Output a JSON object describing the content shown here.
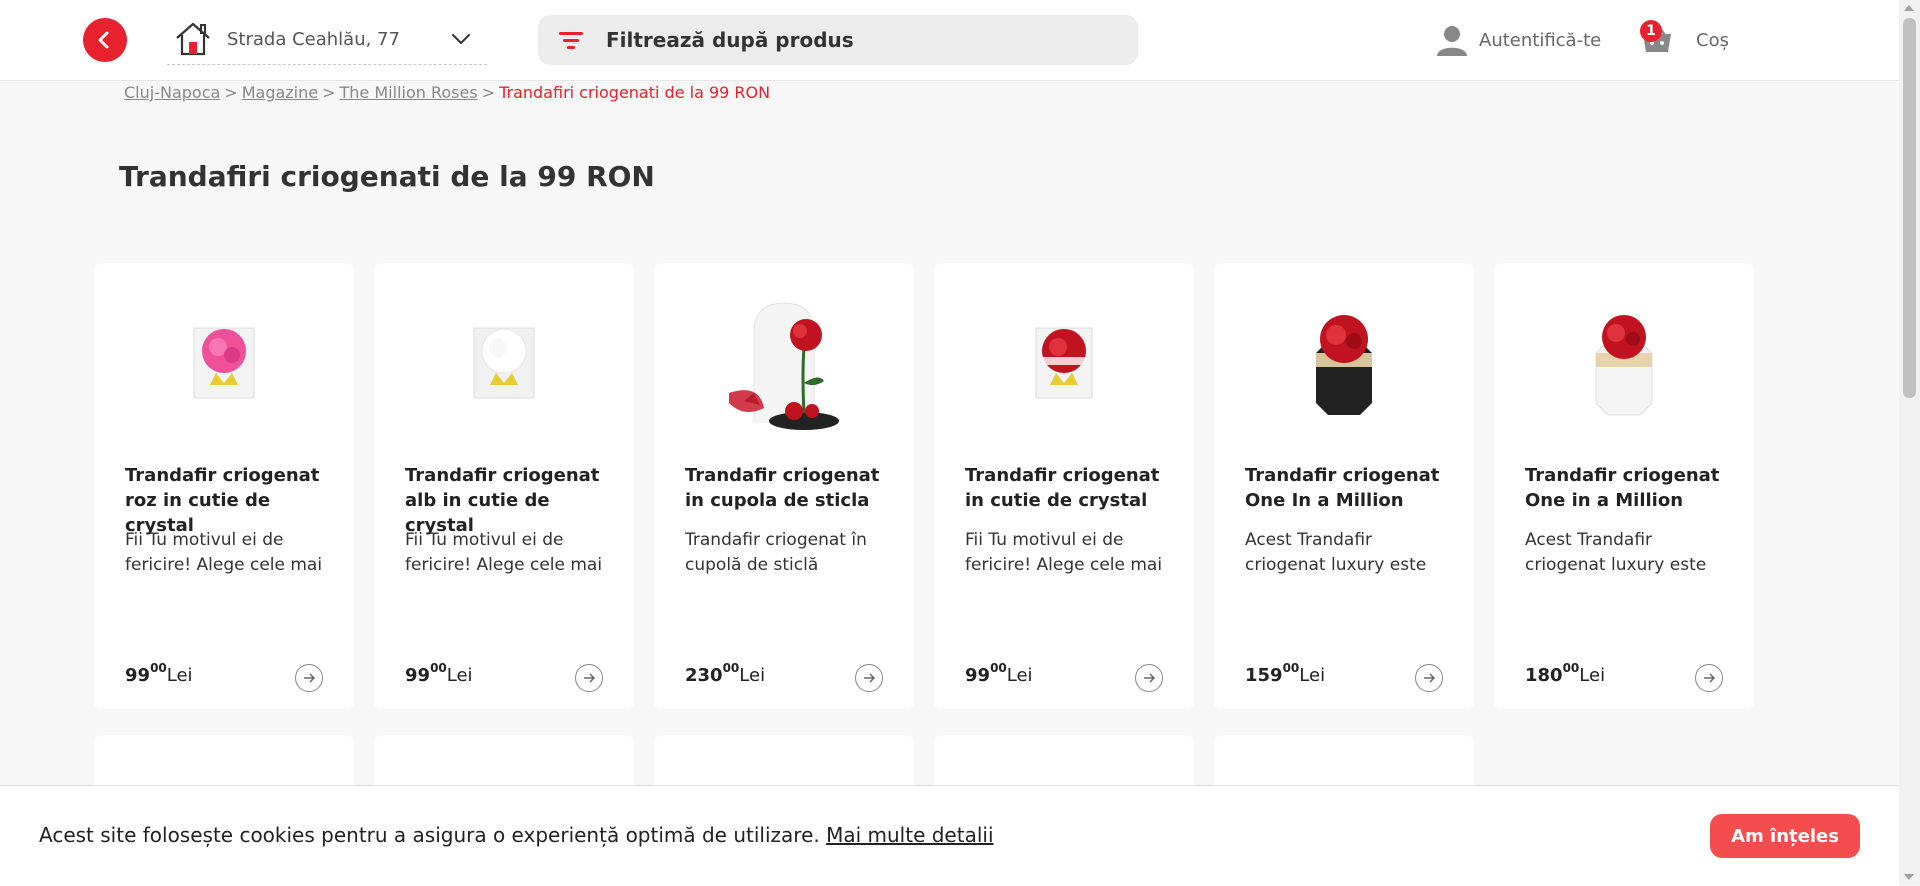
{
  "header": {
    "address": "Strada Ceahlău, 77",
    "search_placeholder": "Filtrează după produs",
    "login_label": "Autentifică-te",
    "cart_label": "Coș",
    "cart_count": "1",
    "accent_color": "#e8212e"
  },
  "breadcrumb": {
    "items": [
      "Cluj-Napoca",
      "Magazine",
      "The Million Roses"
    ],
    "separator": ">",
    "current": "Trandafiri criogenati de la 99 RON"
  },
  "page_title": "Trandafiri criogenati de la 99 RON",
  "products": [
    {
      "name": "Trandafir criogenat roz in cutie de crystal",
      "description": "Fii Tu motivul ei de fericire! Alege cele mai",
      "price_int": "99",
      "price_dec": "00",
      "currency": "Lei",
      "image": "pink-rose-crystal-box"
    },
    {
      "name": "Trandafir criogenat alb in cutie de crystal",
      "description": "Fii Tu motivul ei de fericire! Alege cele mai",
      "price_int": "99",
      "price_dec": "00",
      "currency": "Lei",
      "image": "white-rose-crystal-box"
    },
    {
      "name": "Trandafir criogenat in cupola de sticla",
      "description": "Trandafir criogenat în cupolă de sticlă",
      "price_int": "230",
      "price_dec": "00",
      "currency": "Lei",
      "image": "rose-glass-dome"
    },
    {
      "name": "Trandafir criogenat in cutie de crystal",
      "description": "Fii Tu motivul ei de fericire! Alege cele mai",
      "price_int": "99",
      "price_dec": "00",
      "currency": "Lei",
      "image": "red-rose-crystal-box"
    },
    {
      "name": "Trandafir criogenat One In a Million",
      "description": "Acest Trandafir criogenat luxury este",
      "price_int": "159",
      "price_dec": "00",
      "currency": "Lei",
      "image": "red-rose-black-hexagon-box"
    },
    {
      "name": "Trandafir criogenat One in a Million",
      "description": "Acest Trandafir criogenat luxury este",
      "price_int": "180",
      "price_dec": "00",
      "currency": "Lei",
      "image": "red-rose-white-hexagon-box"
    }
  ],
  "cookie": {
    "text": "Acest site folosește cookies pentru a asigura o experiență optimă de utilizare.",
    "link": "Mai multe detalii",
    "button": "Am înțeles",
    "button_color": "#f54d4d"
  }
}
